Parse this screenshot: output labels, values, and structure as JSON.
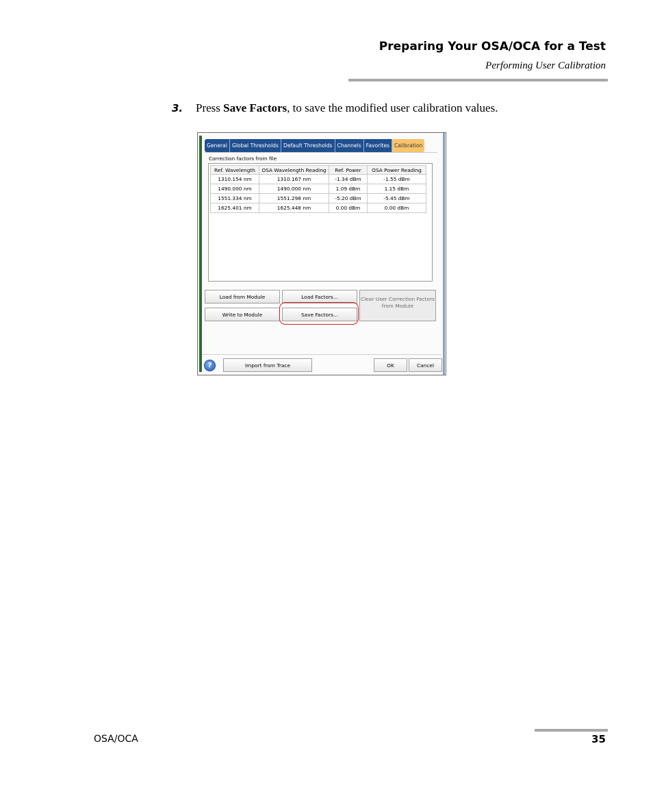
{
  "header": {
    "title": "Preparing Your OSA/OCA for a Test",
    "subtitle": "Performing User Calibration"
  },
  "step": {
    "number": "3.",
    "prefix": "Press ",
    "bold": "Save Factors",
    "suffix": ", to save the modified user calibration values."
  },
  "dialog": {
    "tabs": [
      "General",
      "Global Thresholds",
      "Default Thresholds",
      "Channels",
      "Favorites",
      "Calibration"
    ],
    "active_tab": "Calibration",
    "group_label": "Correction factors from file",
    "table": {
      "columns": [
        "Ref. Wavelength",
        "OSA Wavelength Reading",
        "Ref. Power",
        "OSA Power Reading"
      ],
      "rows": [
        [
          "1310.154 nm",
          "1310.167 nm",
          "-1.34 dBm",
          "-1.55 dBm"
        ],
        [
          "1490.000 nm",
          "1490.000 nm",
          "1.09 dBm",
          "1.15 dBm"
        ],
        [
          "1551.334 nm",
          "1551.298 nm",
          "-5.20 dBm",
          "-5.45 dBm"
        ],
        [
          "1625.401 nm",
          "1625.448 nm",
          "0.00 dBm",
          "0.00 dBm"
        ]
      ]
    },
    "buttons": {
      "load_from_module": "Load from Module",
      "load_factors": "Load Factors...",
      "write_to_module": "Write to Module",
      "save_factors": "Save Factors...",
      "clear_user": "Clear User Correction Factors from Module",
      "help": "?",
      "import_from_trace": "Import from Trace",
      "ok": "OK",
      "cancel": "Cancel"
    },
    "colors": {
      "tab_bg": "#1f4f8f",
      "active_tab_bg": "#f7c36b",
      "highlight": "#d62020"
    }
  },
  "footer": {
    "left": "OSA/OCA",
    "page": "35"
  }
}
